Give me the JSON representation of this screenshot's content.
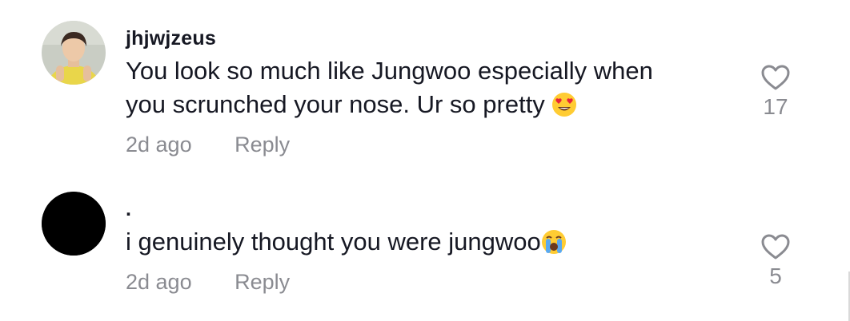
{
  "comments": [
    {
      "username": "jhjwjzeus",
      "text_line1": "You look so much like Jungwoo especially when",
      "text_line2": "you scrunched your nose. Ur so pretty",
      "emoji": "smiling-face-with-heart-eyes",
      "time": "2d ago",
      "reply_label": "Reply",
      "likes": "17",
      "like_icon": "heart-outline-icon"
    },
    {
      "username": ".",
      "text": "i genuinely thought you were jungwoo",
      "emoji": "loudly-crying-face",
      "time": "2d ago",
      "reply_label": "Reply",
      "likes": "5",
      "like_icon": "heart-outline-icon"
    }
  ],
  "colors": {
    "primary_text": "#161823",
    "secondary_text": "#8a8b91",
    "background": "#ffffff"
  }
}
